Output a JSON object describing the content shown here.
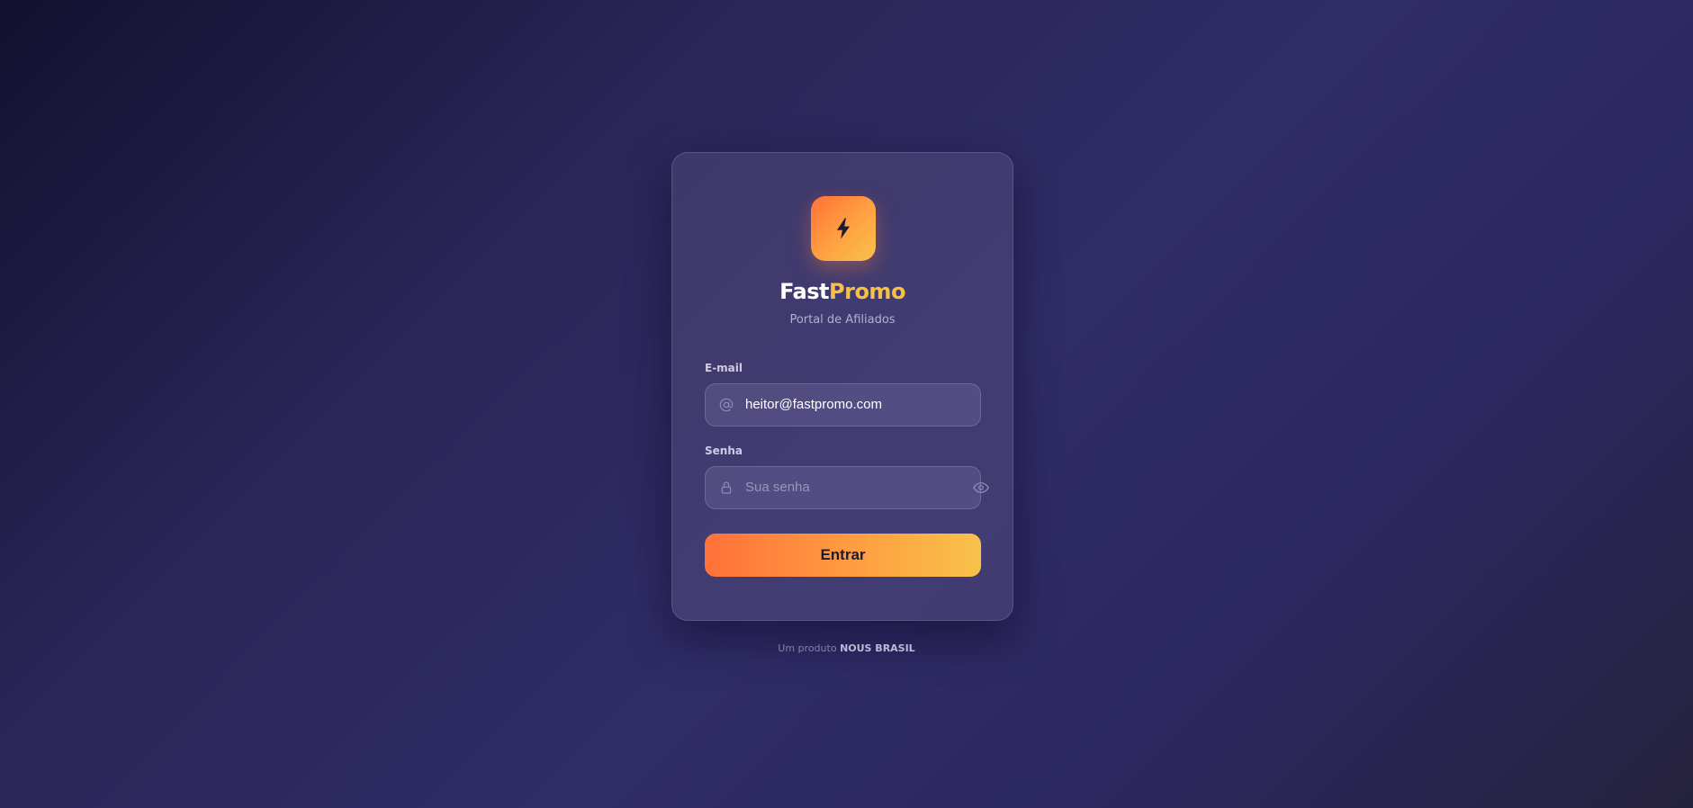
{
  "brand": {
    "name_part1": "Fast",
    "name_part2": "Promo",
    "subtitle": "Portal de Afiliados",
    "logo_icon": "lightning-bolt-icon"
  },
  "form": {
    "email": {
      "label": "E-mail",
      "value": "heitor@fastpromo.com",
      "icon": "at-sign-icon"
    },
    "password": {
      "label": "Senha",
      "value": "",
      "placeholder": "Sua senha",
      "icon": "lock-icon",
      "toggle_icon": "eye-icon"
    },
    "submit_label": "Entrar"
  },
  "footer": {
    "prefix": "Um produto",
    "company": "NOUS BRASIL"
  },
  "colors": {
    "accent_start": "#ff7139",
    "accent_end": "#f8c24a",
    "brand_highlight": "#f7bf45",
    "background_dark": "#13112f",
    "background_mid": "#302c68"
  }
}
